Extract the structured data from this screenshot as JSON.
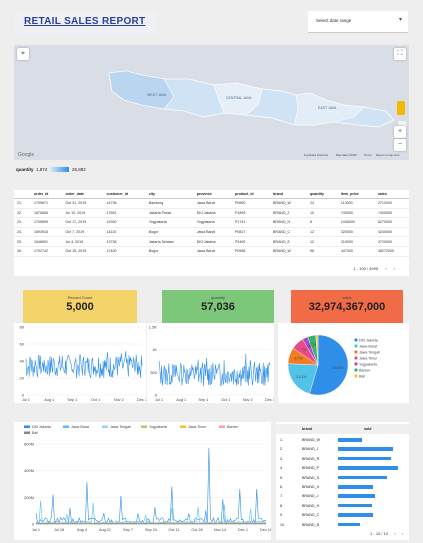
{
  "header": {
    "title": "RETAIL SALES REPORT",
    "date_select_label": "Select date range"
  },
  "map": {
    "regions": [
      "CENTRAL JAVA",
      "EAST JAVA",
      "WEST JAVA"
    ],
    "google_label": "Google",
    "attribution": [
      "Keyboard shortcuts",
      "Map data ©2023",
      "Terms",
      "Report a map error"
    ],
    "legend": {
      "metric": "quantity",
      "min": "1,874",
      "max": "26,882"
    }
  },
  "table": {
    "columns": [
      "order_id",
      "order_date",
      "customer_id",
      "city",
      "province",
      "product_id",
      "brand",
      "quantity",
      "item_price",
      "sales"
    ],
    "rows": [
      [
        "21.",
        "1709671",
        "Oct 31, 2019",
        "14738",
        "Bandung",
        "Jawa Barat",
        "P0890",
        "BRAND_W",
        "24",
        "113000",
        "2712000"
      ],
      [
        "22.",
        "1670806",
        "Jul 10, 2019",
        "17651",
        "Jakarta Pusat",
        "DKI Jakarta",
        "P1899",
        "BRAND_J",
        "10",
        "740000",
        "7400000"
      ],
      [
        "23.",
        "1705699",
        "Oct 17, 2019",
        "12930",
        "Yogyakarta",
        "Yogyakarta",
        "P1741",
        "BRAND_H",
        "6",
        "1045000",
        "6270000"
      ],
      [
        "24.",
        "1694916",
        "Oct 7, 2019",
        "14110",
        "Bogor",
        "Jawa Barat",
        "P0817",
        "BRAND_C",
        "12",
        "320000",
        "4240000"
      ],
      [
        "25.",
        "1646991",
        "Jul 4, 2019",
        "13738",
        "Jakarta Selatan",
        "DKI Jakarta",
        "P2409",
        "BRAND_E",
        "12",
        "310000",
        "3720000"
      ],
      [
        "26.",
        "1702742",
        "Oct 15, 2019",
        "17430",
        "Bogor",
        "Jawa Barat",
        "P0958",
        "BRAND_W",
        "96",
        "447000",
        "38272000"
      ]
    ],
    "pager": "1 - 100 / 4995"
  },
  "scorecards": [
    {
      "caption": "Record Count",
      "value": "5,000",
      "color": "#f5d36b"
    },
    {
      "caption": "quantity",
      "value": "57,036",
      "color": "#7dc77b"
    },
    {
      "caption": "sales",
      "value": "32,974,367,000",
      "color": "#f26b47"
    }
  ],
  "charts": {
    "left_line": {
      "y_ticks": [
        "80",
        "60",
        "40",
        "20",
        "0"
      ],
      "x_ticks": [
        "Jul 1",
        "Aug 1",
        "Sep 1",
        "Oct 1",
        "Nov 2",
        "Dec 3"
      ]
    },
    "mid_line": {
      "y_ticks": [
        "1.5K",
        "1K",
        "500",
        "0"
      ],
      "x_ticks": [
        "Jul 1",
        "Aug 1",
        "Sep 1",
        "Oct 1",
        "Nov 2",
        "Dec 3"
      ]
    },
    "pie": {
      "labels": [
        "DKI Jakarta",
        "Jawa Barat",
        "Jawa Tengah",
        "Jawa Timur",
        "Yogyakarta",
        "Banten",
        "Bali"
      ],
      "slice_labels": [
        "54.6%",
        "21.1%",
        "8.7%",
        "7%",
        "3%",
        "7.2%"
      ],
      "colors": [
        "#2f8ee8",
        "#52c3e8",
        "#f47b20",
        "#e84b8a",
        "#a74ad0",
        "#34b36a",
        "#f1c232"
      ]
    },
    "stacked": {
      "legend": [
        "DKI Jakarta",
        "Jawa Barat",
        "Jawa Tengah",
        "Yogyakarta",
        "Jawa Timur",
        "Banten",
        "Bali"
      ],
      "colors": [
        "#2f8ee8",
        "#52c3e8",
        "#9ad0f0",
        "#a0d070",
        "#f1c232",
        "#f4a6a6",
        "#888888"
      ],
      "y_ticks": [
        "600M",
        "400M",
        "200M",
        "0"
      ],
      "x_ticks": [
        "Jul 1",
        "Jul 18",
        "Aug 4",
        "Aug 21",
        "Sep 7",
        "Sep 24",
        "Oct 11",
        "Oct 28",
        "Nov 14",
        "Dec 1",
        "Dec 18"
      ]
    }
  },
  "brand_table": {
    "columns": [
      "brand",
      "sold"
    ],
    "rows": [
      {
        "rank": "1.",
        "brand": "BRAND_W",
        "frac": 0.4
      },
      {
        "rank": "2.",
        "brand": "BRAND_J",
        "frac": 0.92
      },
      {
        "rank": "3.",
        "brand": "BRAND_R",
        "frac": 0.88
      },
      {
        "rank": "4.",
        "brand": "BRAND_P",
        "frac": 1.0
      },
      {
        "rank": "5.",
        "brand": "BRAND_S",
        "frac": 0.82
      },
      {
        "rank": "6.",
        "brand": "BRAND_H",
        "frac": 0.58
      },
      {
        "rank": "7.",
        "brand": "BRAND_J",
        "frac": 0.62
      },
      {
        "rank": "8.",
        "brand": "BRAND_H",
        "frac": 0.56
      },
      {
        "rank": "9.",
        "brand": "BRAND_C",
        "frac": 0.58
      },
      {
        "rank": "10.",
        "brand": "BRAND_B",
        "frac": 0.36
      }
    ],
    "pager": "1 - 10 / 10"
  }
}
